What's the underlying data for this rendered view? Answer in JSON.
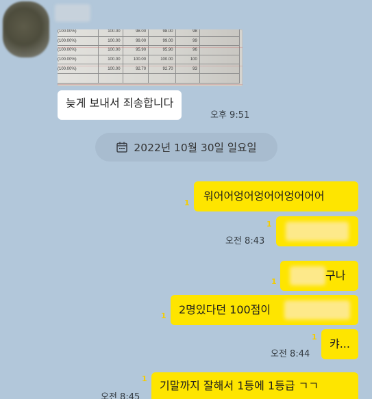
{
  "received": {
    "photo_table_rows": [
      [
        "(100.00%)",
        "100.00",
        "98.00",
        "98.00",
        "98"
      ],
      [
        "(100.00%)",
        "100.00",
        "99.00",
        "99.00",
        "99"
      ],
      [
        "(100.00%)",
        "100.00",
        "95.90",
        "95.90",
        "96"
      ],
      [
        "(100.00%)",
        "100.00",
        "100.00",
        "100.00",
        "100"
      ],
      [
        "(100.00%)",
        "100.00",
        "92.70",
        "92.70",
        "93"
      ]
    ],
    "message": "늦게 보내서 죄송합니다",
    "time": "오후 9:51"
  },
  "date_divider": "2022년 10월 30일 일요일",
  "sent": [
    {
      "text": "워어어엉어엉어어엉어어어",
      "unread": "1"
    },
    {
      "text": "",
      "unread": "1",
      "time": "오전 8:43"
    },
    {
      "text": "구나",
      "unread": "1"
    },
    {
      "text": "2명있다던 100점이",
      "unread": "1"
    },
    {
      "text": "캬...",
      "unread": "1",
      "time": "오전 8:44"
    },
    {
      "text": "기말까지 잘해서 1등에 1등급 ㄱㄱ",
      "unread": "1",
      "time": "오전 8:45"
    }
  ],
  "colors": {
    "background": "#b2c7da",
    "sent_bubble": "#fee500",
    "received_bubble": "#ffffff",
    "unread_count": "#f4cc00"
  }
}
